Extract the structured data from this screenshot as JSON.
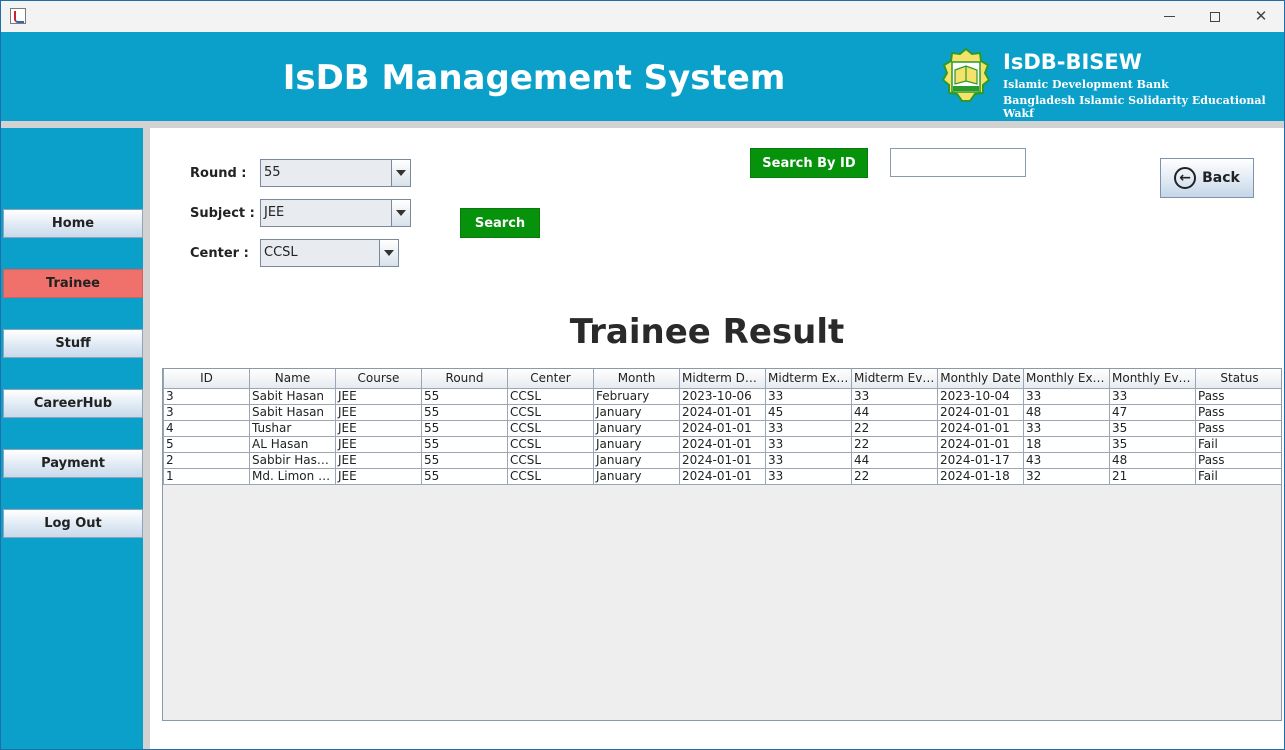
{
  "window": {
    "icons": {
      "app": "java-icon",
      "minimize": "minimize-icon",
      "maximize": "maximize-icon",
      "close": "close-icon"
    }
  },
  "header": {
    "title": "IsDB Management System",
    "org_name": "IsDB-BISEW",
    "org_line1": "Islamic Development Bank",
    "org_line2": "Bangladesh Islamic Solidarity Educational Wakf",
    "logo_text": "IsDB-BISEW",
    "brand_color": "#0aa0c9"
  },
  "sidebar": {
    "items": [
      {
        "label": "Home"
      },
      {
        "label": "Trainee",
        "active": true
      },
      {
        "label": "Stuff"
      },
      {
        "label": "CareerHub"
      },
      {
        "label": "Payment"
      },
      {
        "label": "Log Out"
      }
    ],
    "active_color": "#f0716b"
  },
  "filters": {
    "round_label": "Round :",
    "round_value": "55",
    "subject_label": "Subject :",
    "subject_value": "JEE",
    "center_label": "Center :",
    "center_value": "CCSL",
    "search_label": "Search",
    "search_by_id_label": "Search By ID",
    "search_id_value": "",
    "back_label": "Back"
  },
  "result": {
    "title": "Trainee Result",
    "columns": [
      "ID",
      "Name",
      "Course",
      "Round",
      "Center",
      "Month",
      "Midterm Date",
      "Midterm Exter...",
      "Midterm Evid...",
      "Monthly Date",
      "Monthly Exter...",
      "Monthly Evide...",
      "Status"
    ],
    "rows": [
      [
        "3",
        "Sabit Hasan",
        "JEE",
        "55",
        "CCSL",
        "February",
        "2023-10-06",
        "33",
        "33",
        "2023-10-04",
        "33",
        "33",
        "Pass"
      ],
      [
        "3",
        "Sabit Hasan",
        "JEE",
        "55",
        "CCSL",
        "January",
        "2024-01-01",
        "45",
        "44",
        "2024-01-01",
        "48",
        "47",
        "Pass"
      ],
      [
        "4",
        "Tushar",
        "JEE",
        "55",
        "CCSL",
        "January",
        "2024-01-01",
        "33",
        "22",
        "2024-01-01",
        "33",
        "35",
        "Pass"
      ],
      [
        "5",
        "AL Hasan",
        "JEE",
        "55",
        "CCSL",
        "January",
        "2024-01-01",
        "33",
        "22",
        "2024-01-01",
        "18",
        "35",
        "Fail"
      ],
      [
        "2",
        "Sabbir Hasa...",
        "JEE",
        "55",
        "CCSL",
        "January",
        "2024-01-01",
        "33",
        "44",
        "2024-01-17",
        "43",
        "48",
        "Pass"
      ],
      [
        "1",
        "Md. Limon Isl...",
        "JEE",
        "55",
        "CCSL",
        "January",
        "2024-01-01",
        "33",
        "22",
        "2024-01-18",
        "32",
        "21",
        "Fail"
      ]
    ]
  },
  "colors": {
    "green_button": "#06920a"
  }
}
